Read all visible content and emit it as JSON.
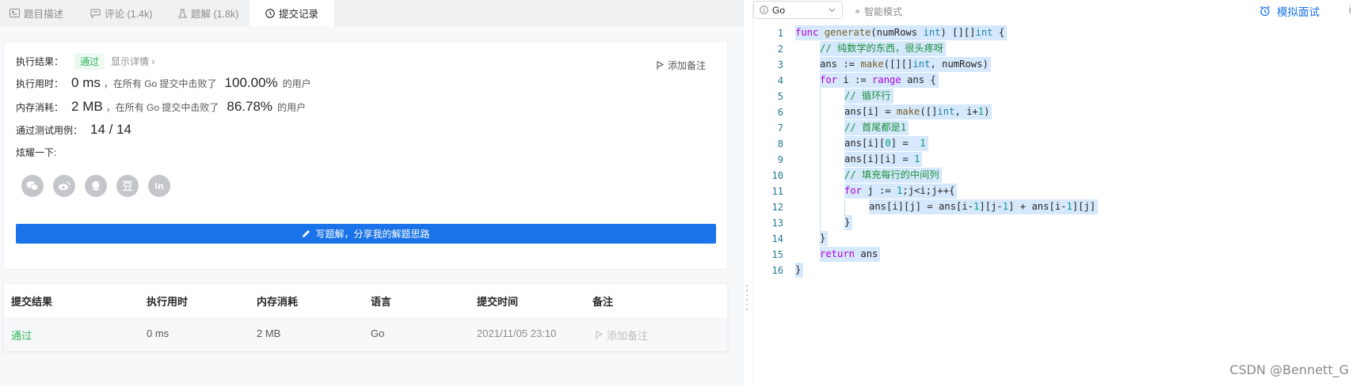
{
  "tabs": [
    {
      "label": "题目描述",
      "icon": "description-icon"
    },
    {
      "label": "评论 (1.4k)",
      "icon": "comment-icon"
    },
    {
      "label": "题解 (1.8k)",
      "icon": "flask-icon"
    },
    {
      "label": "提交记录",
      "icon": "clock-icon"
    }
  ],
  "result": {
    "label": "执行结果：",
    "status": "通过",
    "detail_link": "显示详情 ›",
    "add_note": "添加备注",
    "runtime_label": "执行用时：",
    "runtime_value": "0 ms",
    "runtime_mid": "，在所有 Go 提交中击败了",
    "runtime_percent": "100.00%",
    "users_suffix": "的用户",
    "memory_label": "内存消耗：",
    "memory_value": "2 MB",
    "memory_mid": "，在所有 Go 提交中击败了",
    "memory_percent": "86.78%",
    "tests_label": "通过测试用例：",
    "tests_value": "14 / 14",
    "share_label": "炫耀一下:",
    "share_icons": [
      "wechat-icon",
      "weibo-icon",
      "qq-icon",
      "douban-icon",
      "linkedin-icon"
    ],
    "write_button": "写题解，分享我的解题思路"
  },
  "table": {
    "headers": [
      "提交结果",
      "执行用时",
      "内存消耗",
      "语言",
      "提交时间",
      "备注"
    ],
    "rows": [
      {
        "status": "通过",
        "runtime": "0 ms",
        "memory": "2 MB",
        "language": "Go",
        "time": "2021/11/05 23:10",
        "note": "添加备注"
      }
    ]
  },
  "editor": {
    "language": "Go",
    "smart_mode": "智能模式",
    "mock_interview": "模拟面试",
    "more": "i",
    "line_numbers": [
      "1",
      "2",
      "3",
      "4",
      "5",
      "6",
      "7",
      "8",
      "9",
      "10",
      "11",
      "12",
      "13",
      "14",
      "15",
      "16"
    ]
  },
  "code_comments": {
    "c2": "// 纯数学的东西，很头疼呀",
    "c5": "// 循环行",
    "c7": "// 首尾都是1",
    "c10": "// 填充每行的中间列"
  },
  "watermark": "CSDN @Bennett_G",
  "colors": {
    "accent": "#1a73e8",
    "pass": "#2db55d",
    "selection": "#d5e8fc"
  }
}
